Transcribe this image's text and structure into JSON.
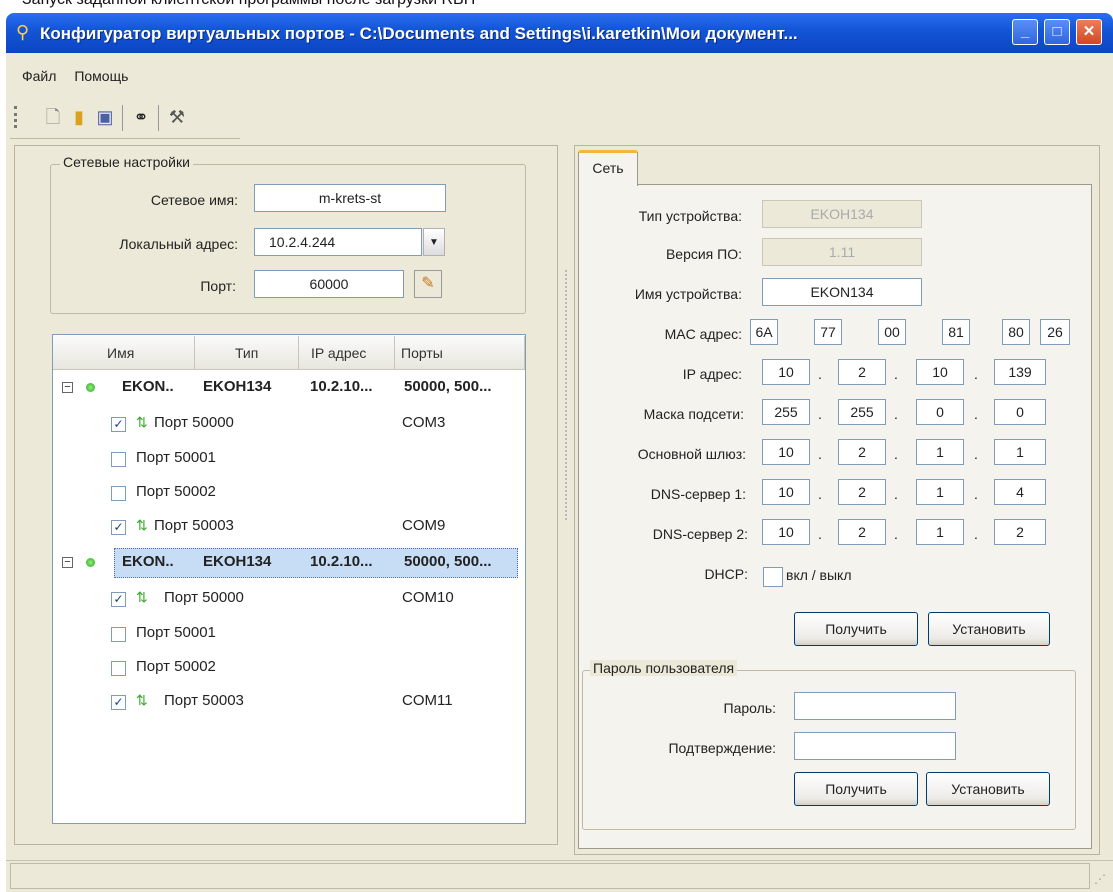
{
  "caption": "Запуск заданной клиентской программы после загрузки RBH",
  "window": {
    "title": "Конфигуратор виртуальных портов - C:\\Documents and Settings\\i.karetkin\\Мои документ...",
    "buttons": [
      "_",
      "□",
      "✕"
    ]
  },
  "menu": [
    "Файл",
    "Помощь"
  ],
  "toolbar": [
    "new-file",
    "open-file",
    "save",
    "find",
    "tools"
  ],
  "network_settings": {
    "title": "Сетевые настройки",
    "name_label": "Сетевое имя:",
    "name_value": "m-krets-st",
    "local_label": "Локальный адрес:",
    "local_value": "10.2.4.244",
    "port_label": "Порт:",
    "port_value": "60000"
  },
  "list": {
    "headers": [
      "Имя",
      "Тип",
      "IP адрес",
      "Порты"
    ],
    "devices": [
      {
        "name": "EKON..",
        "type": "EKOH134",
        "ip": "10.2.10...",
        "ports": "50000, 500...",
        "selected": false,
        "children": [
          {
            "label": "Порт 50000",
            "checked": true,
            "com": "COM3"
          },
          {
            "label": "Порт 50001",
            "checked": false,
            "com": ""
          },
          {
            "label": "Порт 50002",
            "checked": false,
            "com": ""
          },
          {
            "label": "Порт 50003",
            "checked": true,
            "com": "COM9"
          }
        ]
      },
      {
        "name": "EKON..",
        "type": "EKOH134",
        "ip": "10.2.10...",
        "ports": "50000, 500...",
        "selected": true,
        "children": [
          {
            "label": "Порт 50000",
            "checked": true,
            "com": "COM10"
          },
          {
            "label": "Порт 50001",
            "checked": false,
            "com": ""
          },
          {
            "label": "Порт 50002",
            "checked": false,
            "com": ""
          },
          {
            "label": "Порт 50003",
            "checked": true,
            "com": "COM11"
          }
        ]
      }
    ]
  },
  "tab": {
    "label": "Сеть"
  },
  "device": {
    "type_label": "Тип устройства:",
    "type_value": "EKOH134",
    "fw_label": "Версия ПО:",
    "fw_value": "1.11",
    "devname_label": "Имя устройства:",
    "devname_value": "EKON134",
    "mac_label": "MAC адрес:",
    "mac": [
      "6A",
      "77",
      "00",
      "81",
      "80",
      "26"
    ],
    "ip_label": "IP адрес:",
    "ip": [
      "10",
      "2",
      "10",
      "139"
    ],
    "mask_label": "Маска подсети:",
    "mask": [
      "255",
      "255",
      "0",
      "0"
    ],
    "gw_label": "Основной шлюз:",
    "gw": [
      "10",
      "2",
      "1",
      "1"
    ],
    "dns1_label": "DNS-сервер 1:",
    "dns1": [
      "10",
      "2",
      "1",
      "4"
    ],
    "dns2_label": "DNS-сервер 2:",
    "dns2": [
      "10",
      "2",
      "1",
      "2"
    ],
    "dhcp_label": "DHCP:",
    "dhcp_text": "вкл / выкл",
    "get_label": "Получить",
    "set_label": "Установить"
  },
  "password": {
    "title": "Пароль пользователя",
    "pass_label": "Пароль:",
    "confirm_label": "Подтверждение:",
    "get_label": "Получить",
    "set_label": "Установить"
  }
}
